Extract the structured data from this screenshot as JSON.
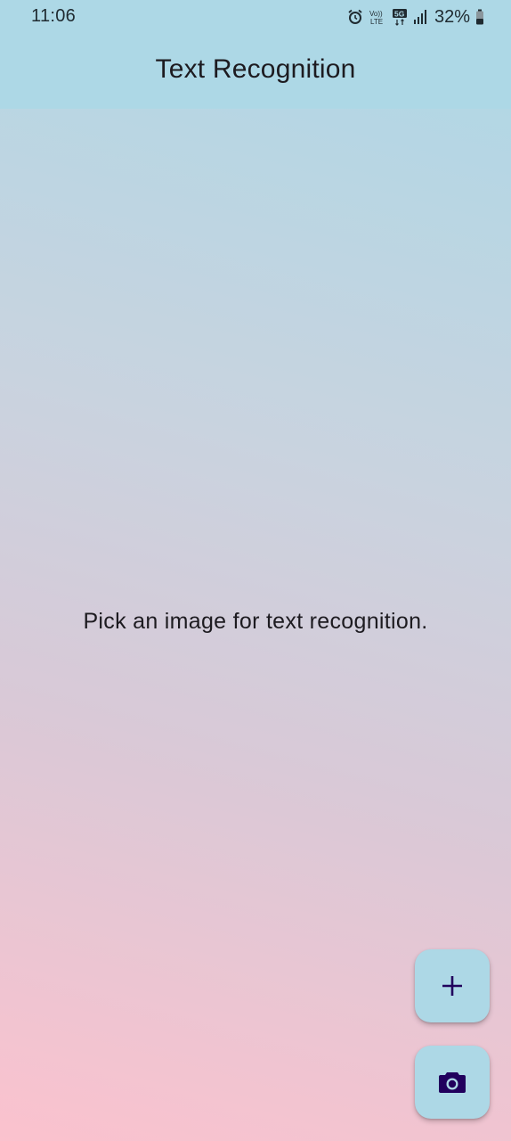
{
  "status_bar": {
    "time": "11:06",
    "battery_percent": "32%",
    "icons": [
      "alarm-icon",
      "volte-icon",
      "5g-icon",
      "signal-icon",
      "battery-icon"
    ]
  },
  "app_bar": {
    "title": "Text Recognition"
  },
  "main": {
    "message": "Pick an image for text recognition."
  },
  "fabs": [
    {
      "icon": "plus-icon"
    },
    {
      "icon": "camera-icon"
    }
  ],
  "colors": {
    "app_bar": "#add8e6",
    "fab": "#add8e6",
    "fab_icon": "#21005d",
    "gradient_bottom": "#fbc2ce",
    "text": "#1d1b20"
  }
}
